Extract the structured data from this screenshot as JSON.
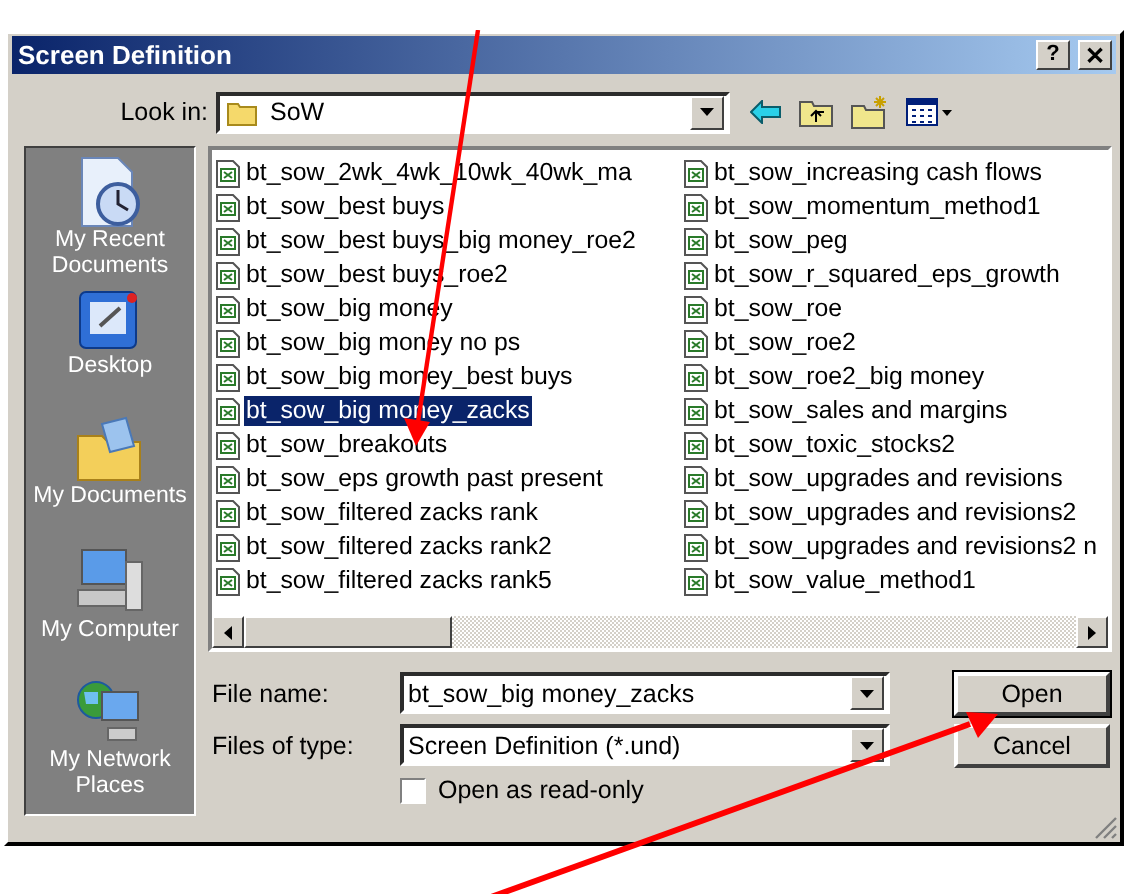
{
  "window": {
    "title": "Screen Definition",
    "title_buttons": [
      {
        "kind": "help",
        "label": "?"
      },
      {
        "kind": "close",
        "label": "✕"
      }
    ]
  },
  "look_in": {
    "label": "Look in:",
    "value": "SoW"
  },
  "places": [
    {
      "kind": "recent",
      "label": "My Recent Documents"
    },
    {
      "kind": "desktop",
      "label": "Desktop"
    },
    {
      "kind": "documents",
      "label": "My Documents"
    },
    {
      "kind": "computer",
      "label": "My Computer"
    },
    {
      "kind": "network",
      "label": "My Network Places"
    }
  ],
  "files": [
    [
      {
        "name": "bt_sow_2wk_4wk_10wk_40wk_ma",
        "selected": false
      },
      {
        "name": "bt_sow_best buys",
        "selected": false
      },
      {
        "name": "bt_sow_best buys_big money_roe2",
        "selected": false
      },
      {
        "name": "bt_sow_best buys_roe2",
        "selected": false
      },
      {
        "name": "bt_sow_big money",
        "selected": false
      },
      {
        "name": "bt_sow_big money no ps",
        "selected": false
      },
      {
        "name": "bt_sow_big money_best buys",
        "selected": false
      },
      {
        "name": "bt_sow_big money_zacks",
        "selected": true
      },
      {
        "name": "bt_sow_breakouts",
        "selected": false
      },
      {
        "name": "bt_sow_eps growth past present",
        "selected": false
      },
      {
        "name": "bt_sow_filtered zacks rank",
        "selected": false
      },
      {
        "name": "bt_sow_filtered zacks rank2",
        "selected": false
      },
      {
        "name": "bt_sow_filtered zacks rank5",
        "selected": false
      }
    ],
    [
      {
        "name": "bt_sow_increasing cash flows",
        "selected": false
      },
      {
        "name": "bt_sow_momentum_method1",
        "selected": false
      },
      {
        "name": "bt_sow_peg",
        "selected": false
      },
      {
        "name": "bt_sow_r_squared_eps_growth",
        "selected": false
      },
      {
        "name": "bt_sow_roe",
        "selected": false
      },
      {
        "name": "bt_sow_roe2",
        "selected": false
      },
      {
        "name": "bt_sow_roe2_big money",
        "selected": false
      },
      {
        "name": "bt_sow_sales and margins",
        "selected": false
      },
      {
        "name": "bt_sow_toxic_stocks2",
        "selected": false
      },
      {
        "name": "bt_sow_upgrades and revisions",
        "selected": false
      },
      {
        "name": "bt_sow_upgrades and revisions2",
        "selected": false
      },
      {
        "name": "bt_sow_upgrades and revisions2 n",
        "selected": false
      },
      {
        "name": "bt_sow_value_method1",
        "selected": false
      }
    ]
  ],
  "file_name": {
    "label": "File name:",
    "value": "bt_sow_big money_zacks"
  },
  "file_type": {
    "label": "Files of type:",
    "value": "Screen Definition (*.und)"
  },
  "read_only": {
    "label": "Open as read-only",
    "checked": false
  },
  "buttons": [
    {
      "label": "Open",
      "default": true
    },
    {
      "label": "Cancel",
      "default": false
    }
  ]
}
